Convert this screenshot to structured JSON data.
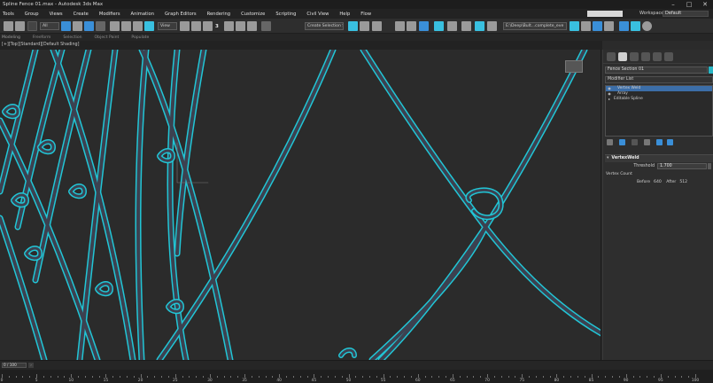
{
  "window": {
    "title": "Spline Fence 01.max - Autodesk 3ds Max",
    "controls": [
      "–",
      "□",
      "✕"
    ]
  },
  "menu": {
    "items": [
      "Tools",
      "Group",
      "Views",
      "Create",
      "Modifiers",
      "Animation",
      "Graph Editors",
      "Rendering",
      "Customize",
      "Scripting",
      "Civil View",
      "Help",
      "Flow"
    ],
    "workspaces_label": "Workspaces:",
    "workspaces_value": "Default"
  },
  "toolbar": {
    "filter": "All",
    "ref_coord": "View",
    "snap_label": "3",
    "selection_set": "Create Selection Se",
    "project_path": "E:\\Deep\\Bult...complete_eve"
  },
  "ribbon": {
    "tabs": [
      "Modeling",
      "Freeform",
      "Selection",
      "Object Paint",
      "Populate"
    ]
  },
  "viewport": {
    "label": "[+][Top][Standard][Default Shading]"
  },
  "command_panel": {
    "tabs": [
      "create-tab-icon",
      "modify-tab-icon",
      "hierarchy-tab-icon",
      "motion-tab-icon",
      "display-tab-icon",
      "utilities-tab-icon"
    ],
    "object_name": "Fence Section 01",
    "object_color": "#29b5c4",
    "modifier_list_label": "Modifier List",
    "stack": [
      {
        "label": "Vertex Weld",
        "selected": true
      },
      {
        "label": "Array",
        "selected": false
      },
      {
        "label": "Editable Spline",
        "selected": false
      }
    ],
    "rollout": {
      "title": "VertexWeld",
      "threshold_label": "Threshold",
      "threshold_value": "1.700",
      "vertex_count_label": "Vertex Count",
      "before_label": "Before",
      "before_value": "640",
      "after_label": "After",
      "after_value": "512"
    }
  },
  "timeline": {
    "current": "0 / 100",
    "labels": [
      "0",
      "5",
      "10",
      "15",
      "20",
      "25",
      "30",
      "35",
      "40",
      "45",
      "50",
      "55",
      "60",
      "65",
      "70",
      "75",
      "80",
      "85",
      "90",
      "95",
      "100"
    ]
  }
}
